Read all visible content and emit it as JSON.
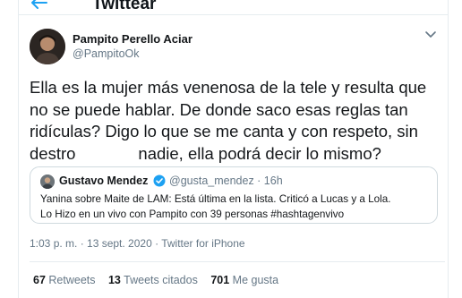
{
  "header": {
    "title": "Twittear"
  },
  "tweet": {
    "author_name": "Pampito Perello Aciar",
    "author_handle": "@PampitoOk",
    "text_lines": [
      "Ella es la mujer más venenosa de la tele y resulta que",
      "no se puede hablar. De donde saco esas reglas tan",
      "ridículas? Digo lo que se me canta y con respeto, sin"
    ],
    "text_line4_start": "destro",
    "text_line4_end": "nadie, ella podrá decir lo mismo?",
    "timestamp": "1:03 p. m. · 13 sept. 2020 · Twitter for iPhone"
  },
  "quote": {
    "author_name": "Gustavo Mendez",
    "author_handle_time": "@gusta_mendez · 16h",
    "text_lines": [
      "Yanina sobre Maite de LAM: Está última en la lista. Criticó a Lucas y a Lola.",
      "Lo Hizo en un vivo con Pampito con 39 personas #hashtagenvivo"
    ]
  },
  "stats": {
    "retweets_count": "67",
    "retweets_label": "Retweets",
    "quote_tweets_count": "13",
    "quote_tweets_label": "Tweets citados",
    "likes_count": "701",
    "likes_label": "Me gusta"
  },
  "colors": {
    "accent": "#1da1f2",
    "secondary_text": "#657786",
    "border": "#e6ecf0"
  },
  "icons": [
    "back-arrow-icon",
    "chevron-down-icon",
    "verified-badge-icon"
  ]
}
